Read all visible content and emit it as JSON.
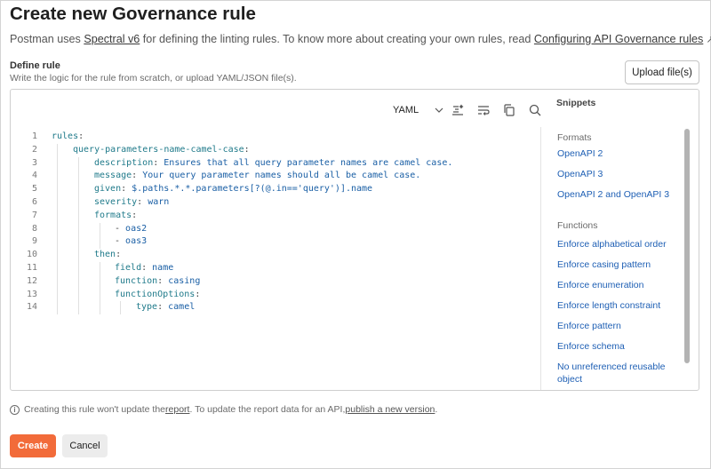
{
  "header": {
    "title": "Create new Governance rule",
    "subtitle_prefix": "Postman uses ",
    "spectral_link": "Spectral v6",
    "subtitle_middle": " for defining the linting rules. To know more about creating your own rules, read ",
    "configuring_link": "Configuring API Governance rules"
  },
  "define": {
    "label": "Define rule",
    "hint": "Write the logic for the rule from scratch, or upload YAML/JSON file(s).",
    "upload_label": "Upload file(s)"
  },
  "editor": {
    "language": "YAML",
    "lines": [
      {
        "n": "1",
        "key": "rules",
        "sep": ":",
        "val": ""
      },
      {
        "n": "2",
        "key": "query-parameters-name-camel-case",
        "sep": ":",
        "val": ""
      },
      {
        "n": "3",
        "key": "description",
        "sep": ": ",
        "val": "Ensures that all query parameter names are camel case."
      },
      {
        "n": "4",
        "key": "message",
        "sep": ": ",
        "val": "Your query parameter names should all be camel case."
      },
      {
        "n": "5",
        "key": "given",
        "sep": ": ",
        "val": "$.paths.*.*.parameters[?(@.in=='query')].name"
      },
      {
        "n": "6",
        "key": "severity",
        "sep": ": ",
        "val": "warn"
      },
      {
        "n": "7",
        "key": "formats",
        "sep": ":",
        "val": ""
      },
      {
        "n": "8",
        "key": "- ",
        "sep": "",
        "val": "oas2"
      },
      {
        "n": "9",
        "key": "- ",
        "sep": "",
        "val": "oas3"
      },
      {
        "n": "10",
        "key": "then",
        "sep": ":",
        "val": ""
      },
      {
        "n": "11",
        "key": "field",
        "sep": ": ",
        "val": "name"
      },
      {
        "n": "12",
        "key": "function",
        "sep": ": ",
        "val": "casing"
      },
      {
        "n": "13",
        "key": "functionOptions",
        "sep": ":",
        "val": ""
      },
      {
        "n": "14",
        "key": "type",
        "sep": ": ",
        "val": "camel"
      }
    ]
  },
  "snippets": {
    "title": "Snippets",
    "formats_label": "Formats",
    "formats": [
      "OpenAPI 2",
      "OpenAPI 3",
      "OpenAPI 2 and OpenAPI 3"
    ],
    "functions_label": "Functions",
    "functions": [
      "Enforce alphabetical order",
      "Enforce casing pattern",
      "Enforce enumeration",
      "Enforce length constraint",
      "Enforce pattern",
      "Enforce schema",
      "No unreferenced reusable object"
    ]
  },
  "info": {
    "prefix": "Creating this rule won't update the ",
    "report_link": "report",
    "middle": ". To update the report data for an API, ",
    "publish_link": "publish a new version",
    "suffix": "."
  },
  "footer": {
    "create_label": "Create",
    "cancel_label": "Cancel"
  },
  "colors": {
    "accent": "#f26b3a",
    "link": "#1e5fb4"
  }
}
